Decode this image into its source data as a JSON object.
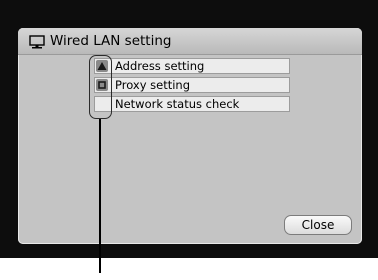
{
  "dialog": {
    "title": "Wired LAN setting",
    "title_icon": "monitor-icon"
  },
  "menu": {
    "items": [
      {
        "label": "Address setting",
        "icon": "triangle-icon"
      },
      {
        "label": "Proxy setting",
        "icon": "square-icon"
      },
      {
        "label": "Network status check",
        "icon": ""
      }
    ]
  },
  "close_button": {
    "label": "Close"
  },
  "colors": {
    "dialog_bg": "#c4c4c4",
    "item_bg": "#ececec",
    "screen_bg": "#0d0d0d"
  }
}
